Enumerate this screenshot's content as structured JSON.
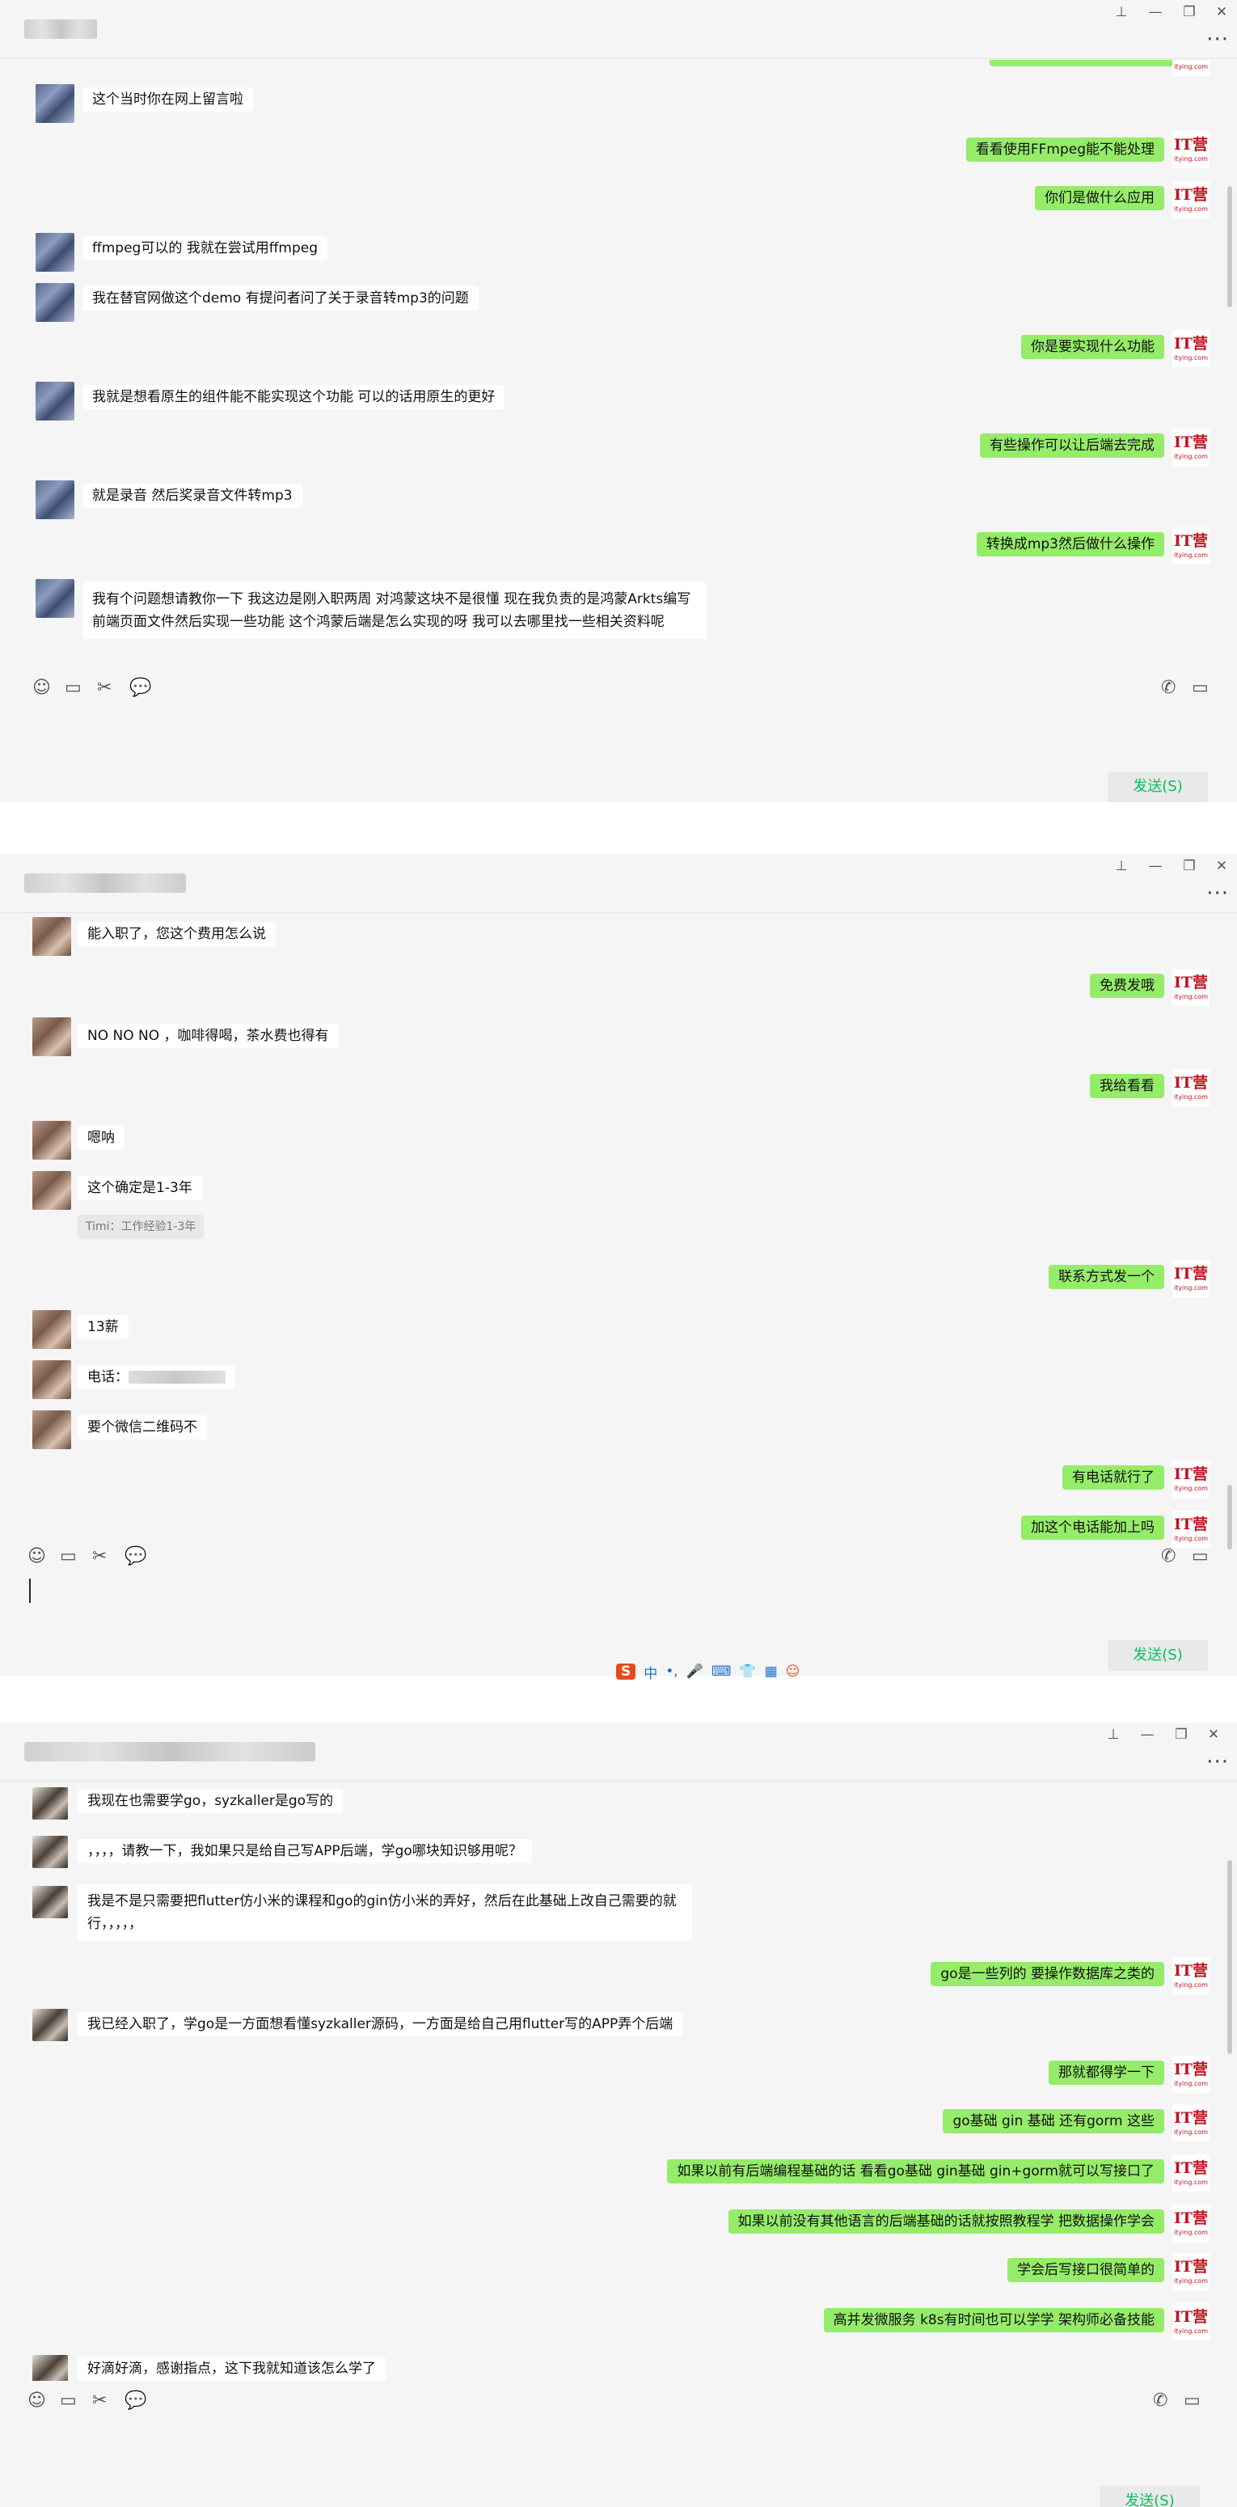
{
  "send_label": "发送(S)",
  "window_controls": {
    "pin": "⊥",
    "minimize": "—",
    "restore": "❐",
    "close": "✕",
    "more": "···"
  },
  "it_logo": {
    "text": "IT营",
    "sub": "itying.com"
  },
  "panel1": {
    "messages": [
      {
        "side": "in",
        "text": "这个当时你在网上留言啦"
      },
      {
        "side": "out",
        "text": "看看使用FFmpeg能不能处理"
      },
      {
        "side": "out",
        "text": "你们是做什么应用"
      },
      {
        "side": "in",
        "text": "ffmpeg可以的 我就在尝试用ffmpeg"
      },
      {
        "side": "in",
        "text": "我在替官网做这个demo 有提问者问了关于录音转mp3的问题"
      },
      {
        "side": "out",
        "text": "你是要实现什么功能"
      },
      {
        "side": "in",
        "text": "我就是想看原生的组件能不能实现这个功能 可以的话用原生的更好"
      },
      {
        "side": "out",
        "text": "有些操作可以让后端去完成"
      },
      {
        "side": "in",
        "text": "就是录音 然后奖录音文件转mp3"
      },
      {
        "side": "out",
        "text": "转换成mp3然后做什么操作"
      },
      {
        "side": "in",
        "text": "我有个问题想请教你一下 我这边是刚入职两周 对鸿蒙这块不是很懂 现在我负责的是鸿蒙Arkts编写前端页面文件然后实现一些功能 这个鸿蒙后端是怎么实现的呀 我可以去哪里找一些相关资料呢"
      }
    ]
  },
  "panel2": {
    "messages": [
      {
        "side": "in",
        "text": "能入职了，您这个费用怎么说"
      },
      {
        "side": "out",
        "text": "免费发哦"
      },
      {
        "side": "in",
        "text": "NO  NO  NO ，咖啡得喝，茶水费也得有"
      },
      {
        "side": "out",
        "text": "我给看看"
      },
      {
        "side": "in",
        "text": "嗯呐"
      },
      {
        "side": "in",
        "text": "这个确定是1-3年"
      },
      {
        "side": "quote",
        "text": "Timi：工作经验1-3年"
      },
      {
        "side": "out",
        "text": "联系方式发一个"
      },
      {
        "side": "in",
        "text": "13薪"
      },
      {
        "side": "in",
        "text": "电话："
      },
      {
        "side": "in",
        "text": "要个微信二维码不"
      },
      {
        "side": "out",
        "text": "有电话就行了"
      },
      {
        "side": "out",
        "text": "加这个电话能加上吗"
      }
    ],
    "ime": {
      "logo": "S",
      "lang": "中",
      "punct": "•,",
      "mic": "🎤",
      "kbd": "⌨",
      "shirt": "👕",
      "grid": "▦",
      "face": "☺"
    }
  },
  "panel3": {
    "messages": [
      {
        "side": "in",
        "text": "我现在也需要学go，syzkaller是go写的"
      },
      {
        "side": "in",
        "text": "，，，，请教一下，我如果只是给自己写APP后端，学go哪块知识够用呢？"
      },
      {
        "side": "in",
        "text": "我是不是只需要把flutter仿小米的课程和go的gin仿小米的弄好，然后在此基础上改自己需要的就行，，，，，"
      },
      {
        "side": "out",
        "text": "go是一些列的   要操作数据库之类的"
      },
      {
        "side": "in",
        "text": "我已经入职了，学go是一方面想看懂syzkaller源码，一方面是给自己用flutter写的APP弄个后端"
      },
      {
        "side": "out",
        "text": "那就都得学一下"
      },
      {
        "side": "out",
        "text": "go基础 gin 基础 还有gorm 这些"
      },
      {
        "side": "out",
        "text": "如果以前有后端编程基础的话  看看go基础 gin基础  gin+gorm就可以写接口了"
      },
      {
        "side": "out",
        "text": "如果以前没有其他语言的后端基础的话就按照教程学   把数据操作学会"
      },
      {
        "side": "out",
        "text": "学会后写接口很简单的"
      },
      {
        "side": "out",
        "text": "高并发微服务  k8s有时间也可以学学  架构师必备技能"
      },
      {
        "side": "in",
        "text": "好滴好滴，感谢指点，这下我就知道该怎么学了"
      }
    ]
  },
  "toolbar_icons": {
    "emoji": "☺",
    "folder": "▭",
    "scissors": "✂",
    "chat": "💬",
    "phone": "✆",
    "video": "▭"
  }
}
